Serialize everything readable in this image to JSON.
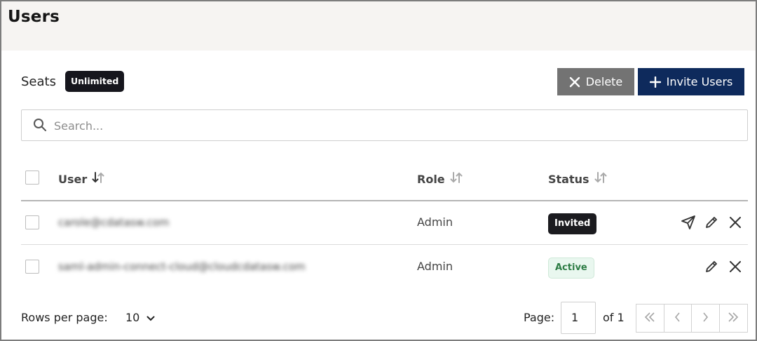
{
  "header": {
    "title": "Users"
  },
  "toolbar": {
    "seats_label": "Seats",
    "seats_badge": "Unlimited",
    "delete_label": "Delete",
    "invite_label": "Invite Users",
    "delete_color": "#737373",
    "invite_color": "#0e2a5c"
  },
  "search": {
    "placeholder": "Search...",
    "value": ""
  },
  "table": {
    "columns": [
      {
        "label": "User",
        "sort_icon": "sort-desc-icon"
      },
      {
        "label": "Role",
        "sort_icon": "sort-icon"
      },
      {
        "label": "Status",
        "sort_icon": "sort-icon"
      }
    ],
    "rows": [
      {
        "user": "carole@cdatasw.com",
        "role": "Admin",
        "status": "Invited",
        "actions": [
          "send-icon",
          "edit-icon",
          "close-icon"
        ]
      },
      {
        "user": "saml-admin-connect-cloud@cloudcdatasw.com",
        "role": "Admin",
        "status": "Active",
        "actions": [
          "edit-icon",
          "close-icon"
        ]
      }
    ]
  },
  "footer": {
    "rows_per_page_label": "Rows per page:",
    "rows_per_page_value": "10",
    "page_label": "Page:",
    "page_value": "1",
    "of_label": "of 1"
  }
}
